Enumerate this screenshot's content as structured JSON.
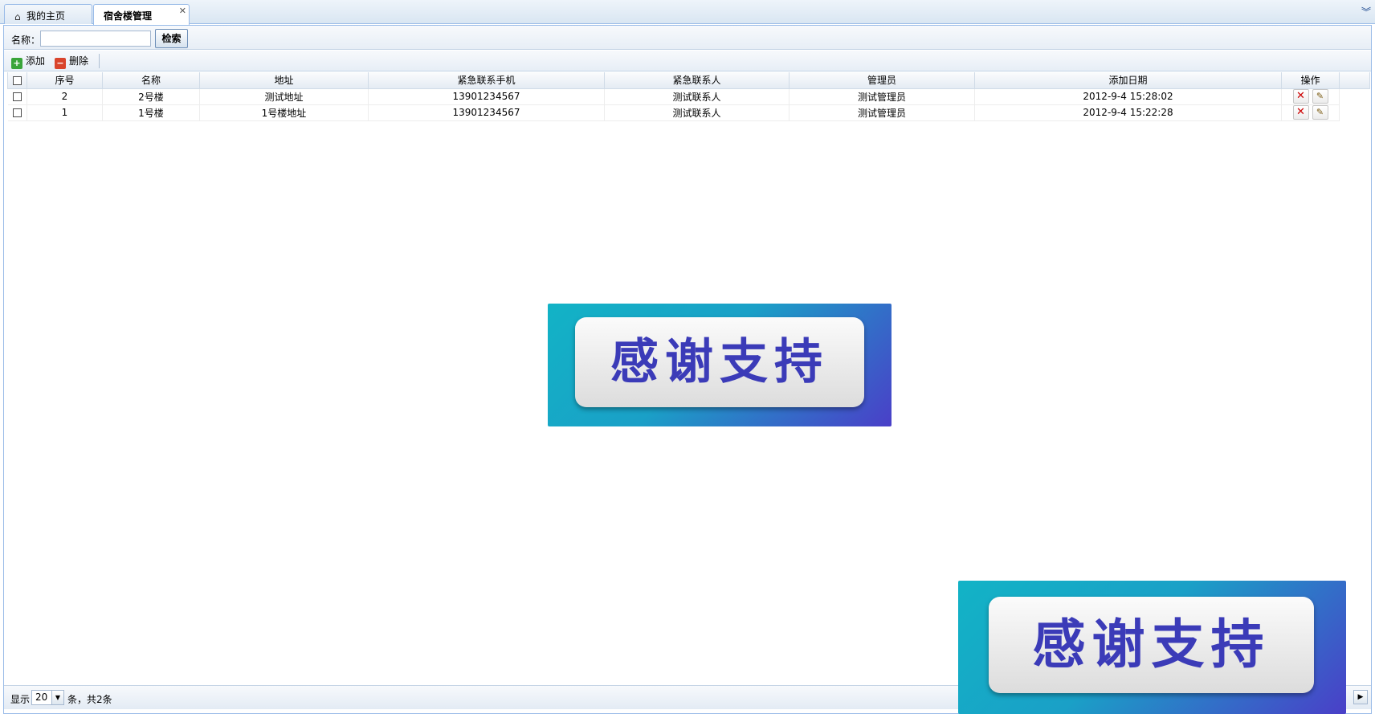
{
  "tabs": [
    {
      "label": "我的主页",
      "icon": "home-icon"
    },
    {
      "label": "宿舍楼管理",
      "icon": "close-icon"
    }
  ],
  "search": {
    "label": "名称：",
    "value": "",
    "placeholder": "",
    "button": "检索"
  },
  "toolbar": {
    "add_label": "添加",
    "delete_label": "删除"
  },
  "grid": {
    "columns": [
      "序号",
      "名称",
      "地址",
      "紧急联系手机",
      "紧急联系人",
      "管理员",
      "添加日期",
      "操作"
    ],
    "rows": [
      {
        "seq": "2",
        "name": "2号楼",
        "address": "测试地址",
        "phone": "13901234567",
        "contact": "测试联系人",
        "admin": "测试管理员",
        "date": "2012-9-4 15:28:02"
      },
      {
        "seq": "1",
        "name": "1号楼",
        "address": "1号楼地址",
        "phone": "13901234567",
        "contact": "测试联系人",
        "admin": "测试管理员",
        "date": "2012-9-4 15:22:28"
      }
    ]
  },
  "pager": {
    "show_label": "显示",
    "page_size": "20",
    "total_label": "条，共2条"
  },
  "banner": {
    "text": "感谢支持"
  },
  "colors": {
    "accent": "#99bbe8",
    "delete": "#cc0000",
    "banner_start": "#12b3c6",
    "banner_end": "#4a3fc8",
    "banner_text": "#3b3bb8"
  }
}
